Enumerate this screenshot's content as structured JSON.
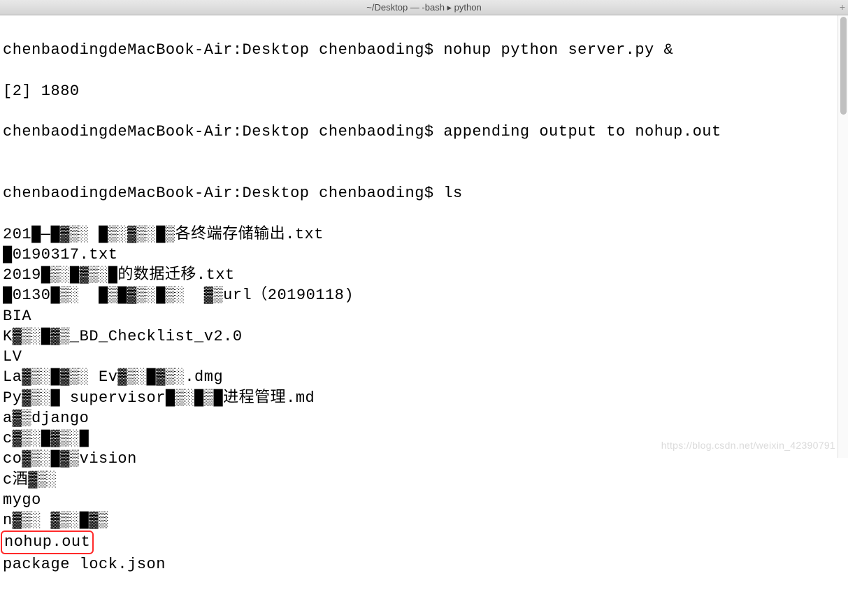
{
  "titlebar": {
    "title": "~/Desktop — -bash ▸ python",
    "plus": "+"
  },
  "terminal": {
    "line1_prompt": "chenbaodingdeMacBook-Air:Desktop chenbaoding$ ",
    "line1_cmd": "nohup python server.py &",
    "line2": "[2] 1880",
    "line3_prompt": "chenbaodingdeMacBook-Air:Desktop chenbaoding$ ",
    "line3_msg": "appending output to nohup.out",
    "line4": "",
    "line5_prompt": "chenbaodingdeMacBook-Air:Desktop chenbaoding$ ",
    "line5_cmd": "ls",
    "ls_output": [
      "201█—█▓▒░ █▒░▓▒░█▒各终端存储输出.txt",
      "█0190317.txt",
      "2019█▒░█▓▒░█的数据迁移.txt",
      "█0130█▒░  █▒█▓▒░█▒░  ▓▒url（20190118)",
      "BIA",
      "K▓▒░█▓▒_BD_Checklist_v2.0",
      "LV",
      "La▓▒░█▓▒░ Ev▓▒░█▓▒░.dmg",
      "Py▓▒░█ supervisor█▒░█▒█进程管理.md",
      "a▓▒django",
      "c▓▒░█▓▒░█",
      "co▓▒░█▓▒vision",
      "c酒▓▒░",
      "mygo",
      "n▓▒░ ▓▒░█▓▒",
      "nohup.out",
      "package lock.json"
    ],
    "highlighted_index": 15
  },
  "watermark": "https://blog.csdn.net/weixin_42390791"
}
